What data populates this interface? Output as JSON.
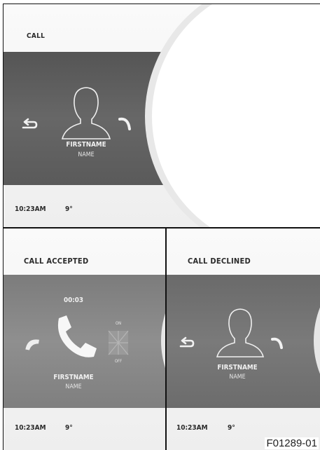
{
  "top_panel": {
    "title": "CALL",
    "caller_firstname": "FIRSTNAME",
    "caller_name": "NAME",
    "time": "10:23AM",
    "temperature": "9°",
    "icons": [
      "return-arrow-icon",
      "person-silhouette-icon",
      "accept-call-arrow-icon"
    ]
  },
  "left_panel": {
    "title": "CALL ACCEPTED",
    "call_duration": "00:03",
    "caller_firstname": "FIRSTNAME",
    "caller_name": "NAME",
    "side_label_top": "ON",
    "side_label_bottom": "OFF",
    "time": "10:23AM",
    "temperature": "9°",
    "icons": [
      "hang-up-icon",
      "phone-handset-icon",
      "mute-toggle-icon"
    ]
  },
  "right_panel": {
    "title": "CALL DECLINED",
    "caller_firstname": "FIRSTNAME",
    "caller_name": "NAME",
    "time": "10:23AM",
    "temperature": "9°",
    "icons": [
      "return-arrow-icon",
      "person-silhouette-icon",
      "accept-call-arrow-icon"
    ]
  },
  "figure_code": "F01289-01",
  "colors": {
    "band_dark": "#5f5f5f",
    "band_mid": "#888888",
    "dial_white": "#ffffff",
    "text_dark": "#2a2a2a"
  }
}
